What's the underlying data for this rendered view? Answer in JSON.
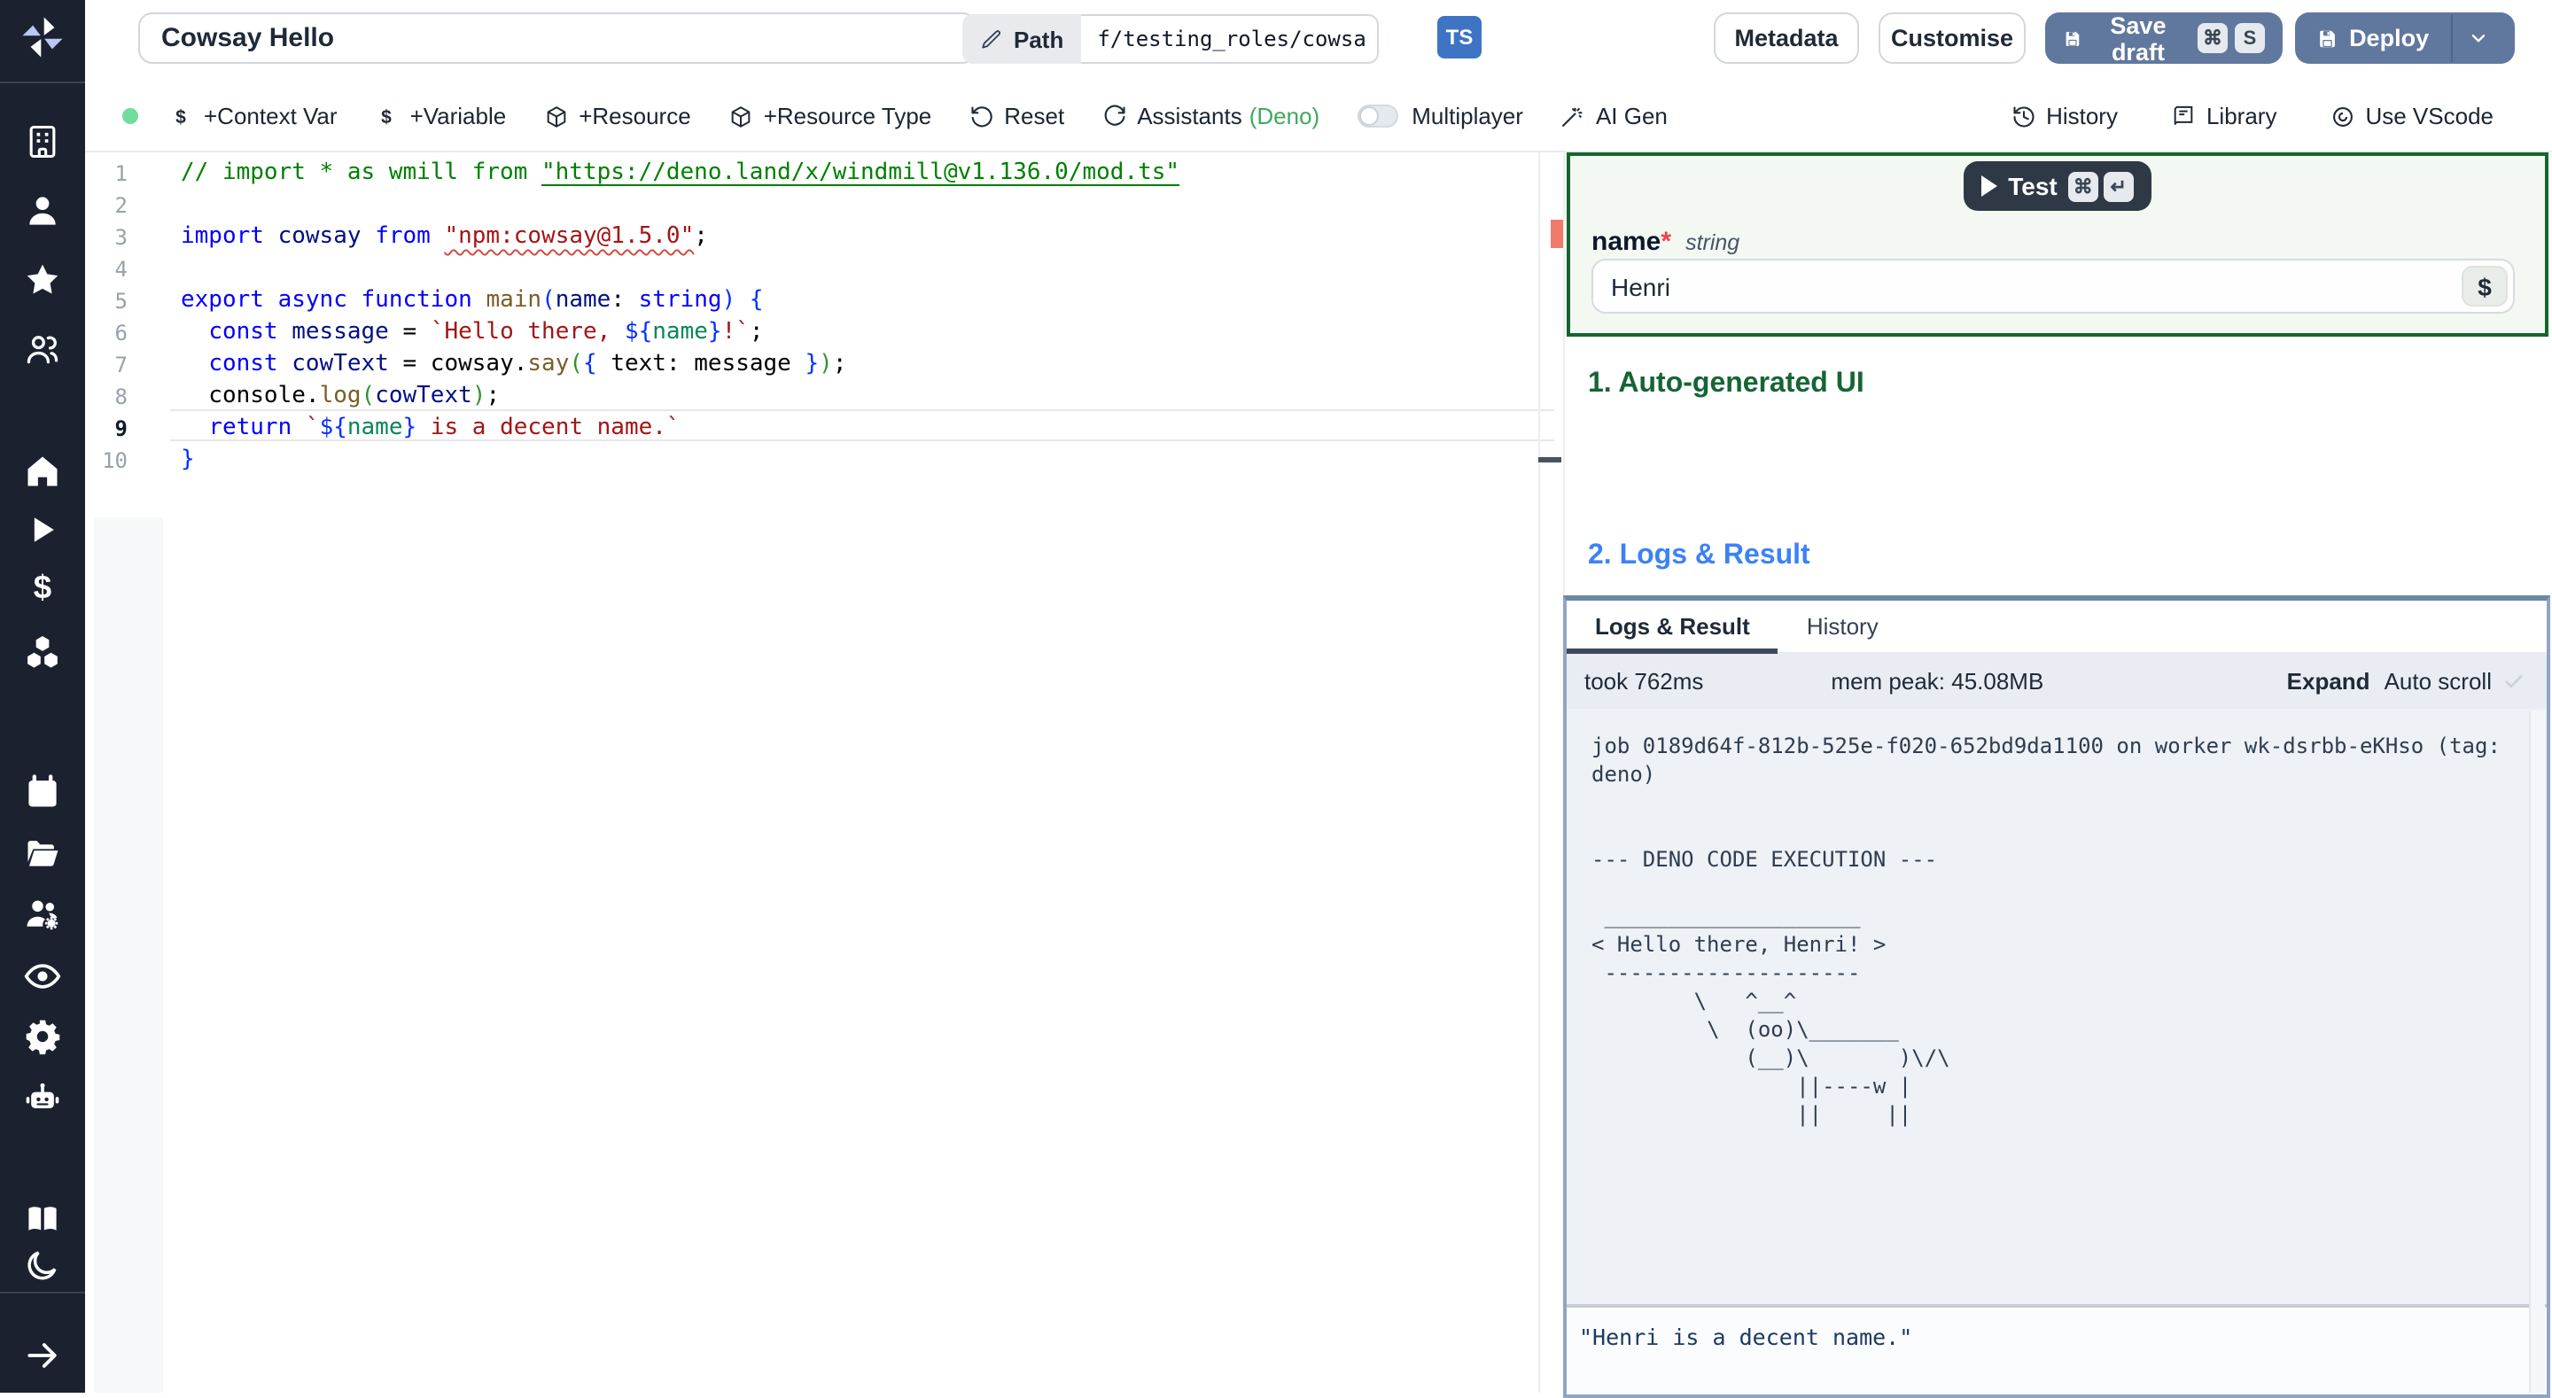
{
  "topbar": {
    "title_value": "Cowsay Hello",
    "path_button": "Path",
    "path_value": "f/testing_roles/cowsa",
    "lang_badge": "TS",
    "metadata": "Metadata",
    "customise": "Customise",
    "save_draft": "Save draft",
    "save_kbd": [
      "⌘",
      "S"
    ],
    "deploy": "Deploy"
  },
  "toolbar": {
    "left_items": [
      {
        "icon": "dollar",
        "label": "+Context Var"
      },
      {
        "icon": "dollar",
        "label": "+Variable"
      },
      {
        "icon": "package",
        "label": "+Resource"
      },
      {
        "icon": "package",
        "label": "+Resource Type"
      },
      {
        "icon": "rotate-ccw",
        "label": "Reset"
      },
      {
        "icon": "refresh",
        "label": "Assistants ",
        "accent": "(Deno)"
      }
    ],
    "multiplayer_label": "Multiplayer",
    "ai_gen": {
      "icon": "wand",
      "label": "AI Gen"
    },
    "right_items": [
      {
        "icon": "history",
        "label": "History"
      },
      {
        "icon": "library",
        "label": "Library"
      },
      {
        "icon": "vscode",
        "label": "Use VScode"
      }
    ]
  },
  "sidebar": {
    "icons": [
      "building",
      "user",
      "star",
      "users",
      "home",
      "play",
      "dollar-big",
      "boxes",
      "calendar",
      "folder",
      "users-cog",
      "eye",
      "gear",
      "bot",
      "book",
      "moon",
      "arrow-right"
    ]
  },
  "editor": {
    "active_line": 9,
    "lines": [
      {
        "n": 1,
        "tokens": [
          {
            "t": "// import * as wmill from ",
            "c": "com"
          },
          {
            "t": "\"https://deno.land/x/windmill@v1.136.0/mod.ts\"",
            "c": "com",
            "u": 1
          }
        ]
      },
      {
        "n": 2,
        "tokens": []
      },
      {
        "n": 3,
        "tokens": [
          {
            "t": "import",
            "c": "kw"
          },
          {
            "t": " cowsay ",
            "c": "id"
          },
          {
            "t": "from",
            "c": "kw"
          },
          {
            "t": " ",
            "c": "pl"
          },
          {
            "t": "\"npm:cowsay@1.5.0\"",
            "c": "str",
            "q": 1
          },
          {
            "t": ";",
            "c": "pl"
          }
        ]
      },
      {
        "n": 4,
        "tokens": []
      },
      {
        "n": 5,
        "tokens": [
          {
            "t": "export",
            "c": "kw"
          },
          {
            "t": " ",
            "c": "pl"
          },
          {
            "t": "async",
            "c": "kw"
          },
          {
            "t": " ",
            "c": "pl"
          },
          {
            "t": "function",
            "c": "kw"
          },
          {
            "t": " ",
            "c": "pl"
          },
          {
            "t": "main",
            "c": "fn"
          },
          {
            "t": "(",
            "c": "br1"
          },
          {
            "t": "name",
            "c": "id"
          },
          {
            "t": ": ",
            "c": "pl"
          },
          {
            "t": "string",
            "c": "kw"
          },
          {
            "t": ")",
            "c": "br1"
          },
          {
            "t": " {",
            "c": "br1"
          }
        ]
      },
      {
        "n": 6,
        "tokens": [
          {
            "t": "  ",
            "c": "pl"
          },
          {
            "t": "const",
            "c": "kw"
          },
          {
            "t": " message ",
            "c": "id"
          },
          {
            "t": "= ",
            "c": "pl"
          },
          {
            "t": "`Hello there, ",
            "c": "str"
          },
          {
            "t": "${",
            "c": "tpl"
          },
          {
            "t": "name",
            "c": "tn"
          },
          {
            "t": "}",
            "c": "tpl"
          },
          {
            "t": "!`",
            "c": "str"
          },
          {
            "t": ";",
            "c": "pl"
          }
        ]
      },
      {
        "n": 7,
        "tokens": [
          {
            "t": "  ",
            "c": "pl"
          },
          {
            "t": "const",
            "c": "kw"
          },
          {
            "t": " cowText ",
            "c": "id"
          },
          {
            "t": "= cowsay.",
            "c": "pl"
          },
          {
            "t": "say",
            "c": "fn"
          },
          {
            "t": "(",
            "c": "br2"
          },
          {
            "t": "{",
            "c": "br1"
          },
          {
            "t": " text: message ",
            "c": "pl"
          },
          {
            "t": "}",
            "c": "br1"
          },
          {
            "t": ")",
            "c": "br2"
          },
          {
            "t": ";",
            "c": "pl"
          }
        ]
      },
      {
        "n": 8,
        "tokens": [
          {
            "t": "  console.",
            "c": "pl"
          },
          {
            "t": "log",
            "c": "fn"
          },
          {
            "t": "(",
            "c": "br2"
          },
          {
            "t": "cowText",
            "c": "id"
          },
          {
            "t": ")",
            "c": "br2"
          },
          {
            "t": ";",
            "c": "pl"
          }
        ]
      },
      {
        "n": 9,
        "tokens": [
          {
            "t": "  ",
            "c": "pl"
          },
          {
            "t": "return",
            "c": "kw"
          },
          {
            "t": " ",
            "c": "pl"
          },
          {
            "t": "`",
            "c": "str"
          },
          {
            "t": "${",
            "c": "tpl"
          },
          {
            "t": "name",
            "c": "tn"
          },
          {
            "t": "}",
            "c": "tpl"
          },
          {
            "t": " is a decent name.`",
            "c": "str"
          }
        ]
      },
      {
        "n": 10,
        "tokens": [
          {
            "t": "}",
            "c": "br1"
          }
        ]
      }
    ]
  },
  "preview": {
    "test_label": "Test",
    "test_kbd": [
      "⌘",
      "↵"
    ],
    "field": {
      "name": "name",
      "required": "*",
      "type": "string",
      "value": "Henri",
      "var_picker": "$"
    },
    "section1": "1. Auto-generated UI",
    "section2": "2. Logs & Result",
    "tabs": [
      "Logs & Result",
      "History"
    ],
    "took": "took 762ms",
    "mem": "mem peak: 45.08MB",
    "expand": "Expand",
    "autoscroll": "Auto scroll",
    "log": "job 0189d64f-812b-525e-f020-652bd9da1100 on worker wk-dsrbb-eKHso (tag:\ndeno)\n\n\n--- DENO CODE EXECUTION ---\n\n ____________________\n< Hello there, Henri! >\n --------------------\n        \\   ^__^\n         \\  (oo)\\_______\n            (__)\\       )\\/\\\n                ||----w |\n                ||     ||",
    "result": "\"Henri is a decent name.\""
  },
  "colors": {
    "sidebar_bg": "#1c2130",
    "ts_badge": "#3d74c4",
    "primary_button": "#61789e",
    "schema_border": "#15652f",
    "heading_green": "#166534",
    "heading_blue": "#3c82f6",
    "status_dot": "#72db9f",
    "deno_green": "#3fa95c",
    "error_marker": "#ee7a6a"
  }
}
